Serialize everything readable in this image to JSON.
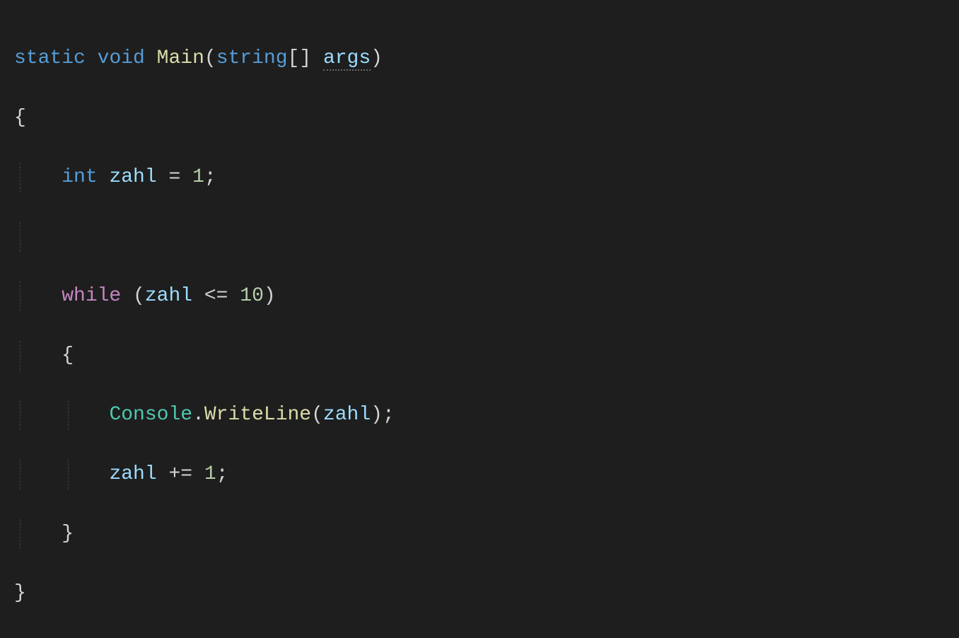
{
  "code": {
    "line1": {
      "static": "static",
      "void": "void",
      "main": "Main",
      "paren_open": "(",
      "string_type": "string",
      "brackets": "[]",
      "args": "args",
      "paren_close": ")"
    },
    "line2": {
      "brace_open": "{"
    },
    "line3": {
      "int_type": "int",
      "var_name": "zahl",
      "equals": " = ",
      "value": "1",
      "semicolon": ";"
    },
    "line5": {
      "while_kw": "while",
      "paren_open": " (",
      "var_name": "zahl",
      "op": " <= ",
      "value": "10",
      "paren_close": ")"
    },
    "line6": {
      "brace_open": "{"
    },
    "line7": {
      "console": "Console",
      "dot": ".",
      "writeline": "WriteLine",
      "paren_open": "(",
      "var_name": "zahl",
      "paren_close": ")",
      "semicolon": ";"
    },
    "line8": {
      "var_name": "zahl",
      "op": " += ",
      "value": "1",
      "semicolon": ";"
    },
    "line9": {
      "brace_close": "}"
    },
    "line10": {
      "brace_close": "}"
    }
  }
}
